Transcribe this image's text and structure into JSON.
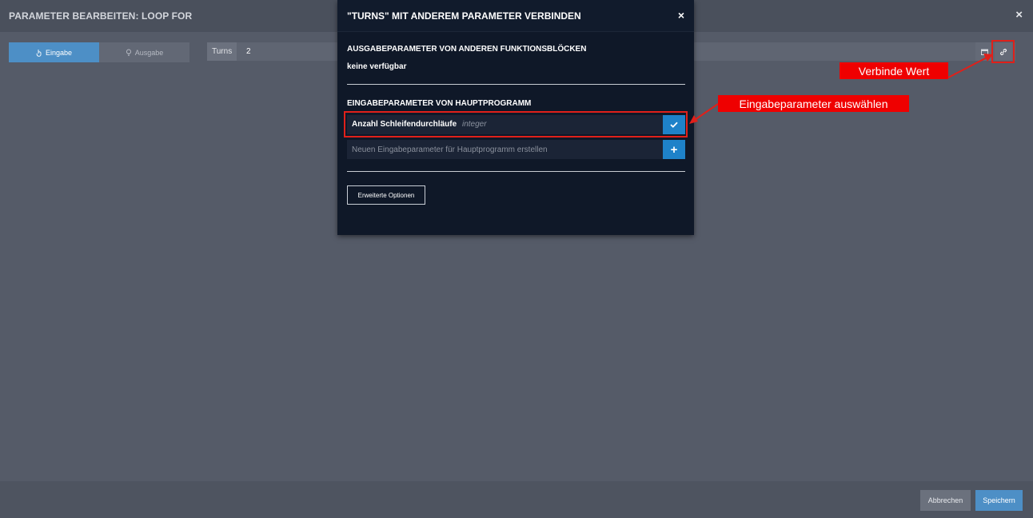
{
  "background_dialog": {
    "title": "PARAMETER BEARBEITEN: LOOP FOR",
    "close_glyph": "×",
    "tabs": [
      {
        "label": "Eingabe",
        "icon": "pointer-icon",
        "active": true
      },
      {
        "label": "Ausgabe",
        "icon": "lightbulb-icon",
        "active": false
      }
    ],
    "parameter": {
      "label": "Turns",
      "value": "2"
    },
    "footer": {
      "cancel_label": "Abbrechen",
      "save_label": "Speichern"
    }
  },
  "modal": {
    "title": "\"TURNS\" MIT ANDEREM PARAMETER VERBINDEN",
    "close_glyph": "×",
    "section_output": {
      "title": "AUSGABEPARAMETER VON ANDEREN FUNKTIONSBLÖCKEN",
      "empty_text": "keine verfügbar"
    },
    "section_input": {
      "title": "EINGABEPARAMETER VON HAUPTPROGRAMM",
      "options": [
        {
          "name": "Anzahl Schleifendurchläufe",
          "type": "integer"
        }
      ],
      "new_placeholder": "Neuen Eingabeparameter für Hauptprogramm erstellen",
      "plus_glyph": "+"
    },
    "advanced_label": "Erweiterte Optionen"
  },
  "annotations": {
    "connect_value": "Verbinde Wert",
    "select_input_param": "Eingabeparameter auswählen"
  },
  "colors": {
    "accent": "#1e82c9",
    "tab_active": "#4d8fc6",
    "annotation_red": "#ef0000",
    "modal_bg": "#0f1828"
  }
}
